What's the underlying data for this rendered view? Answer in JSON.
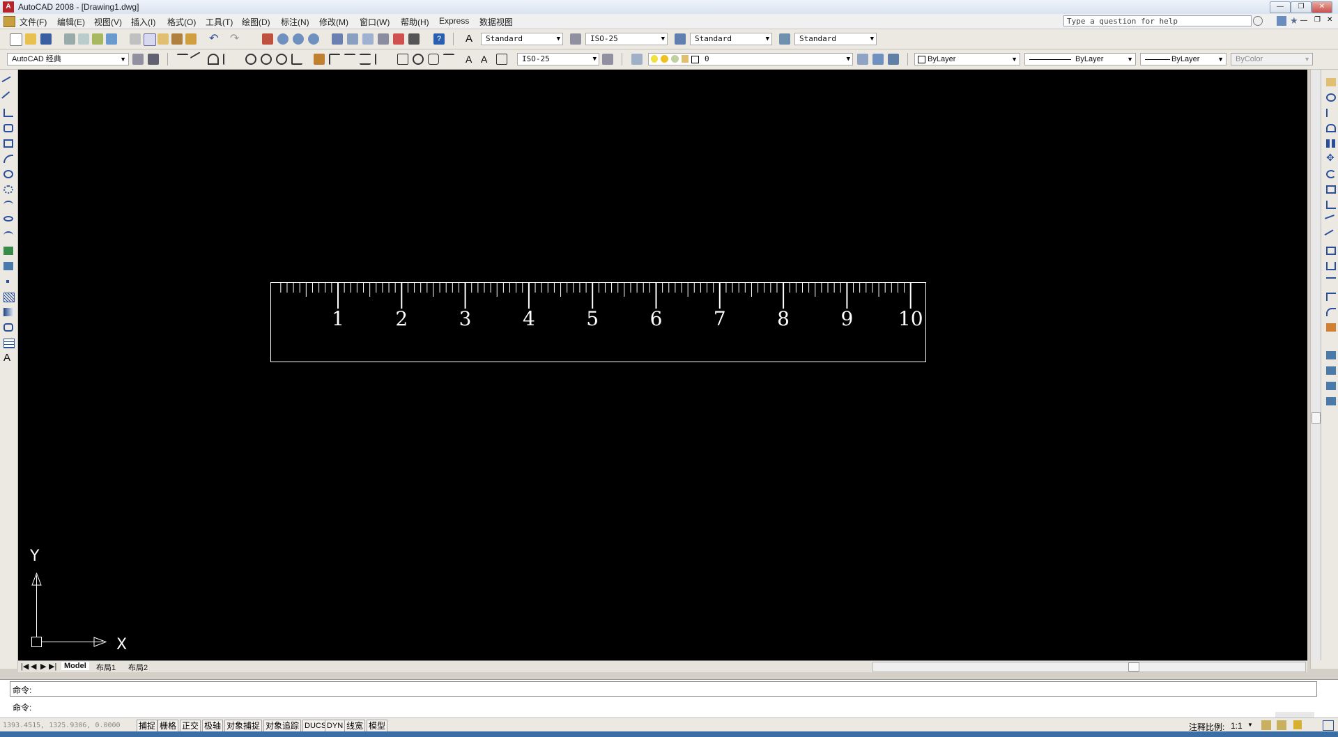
{
  "window": {
    "title": "AutoCAD 2008 - [Drawing1.dwg]",
    "help_placeholder": "Type a question for help"
  },
  "menu": [
    "文件(F)",
    "编辑(E)",
    "视图(V)",
    "插入(I)",
    "格式(O)",
    "工具(T)",
    "绘图(D)",
    "标注(N)",
    "修改(M)",
    "窗口(W)",
    "帮助(H)",
    "Express",
    "数据视图"
  ],
  "toolbar1": {
    "text_style": "Standard",
    "dim_style": "ISO-25",
    "table_style": "Standard",
    "multileader_style": "Standard"
  },
  "toolbar2": {
    "workspace": "AutoCAD 经典",
    "dim_style": "ISO-25",
    "layer": "0",
    "color": "ByLayer",
    "linetype": "ByLayer",
    "lineweight": "ByLayer",
    "plotstyle": "ByColor"
  },
  "ruler": {
    "labels": [
      "1",
      "2",
      "3",
      "4",
      "5",
      "6",
      "7",
      "8",
      "9",
      "10"
    ],
    "minor_per_major": 10
  },
  "ucs": {
    "x_label": "X",
    "y_label": "Y"
  },
  "tabs": [
    "Model",
    "布局1",
    "布局2"
  ],
  "command": {
    "line1": "命令:",
    "line2": "命令:"
  },
  "status": {
    "coords": "1393.4515, 1325.9306, 0.0000",
    "toggles": [
      "捕捉",
      "栅格",
      "正交",
      "极轴",
      "对象捕捉",
      "对象追踪",
      "DUCS",
      "DYN",
      "线宽",
      "模型"
    ],
    "annotation_scale_label": "注释比例:",
    "annotation_scale_value": "1:1"
  }
}
